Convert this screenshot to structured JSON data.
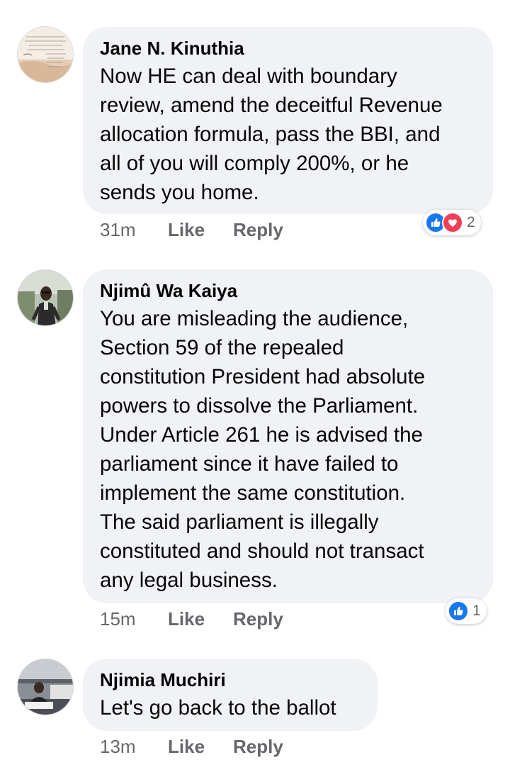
{
  "comments": [
    {
      "author": "Jane N. Kinuthia",
      "text": "Now HE can deal with boundary\nreview, amend the deceitful Revenue\nallocation formula, pass the BBI, and\nall of you will comply 200%, or he\nsends you home.",
      "time": "31m",
      "like_label": "Like",
      "reply_label": "Reply",
      "reactions": {
        "icons": [
          "like-icon",
          "love-icon"
        ],
        "count": "2"
      }
    },
    {
      "author": "Njimû Wa Kaiya",
      "text": "You are misleading the audience,\nSection 59 of the repealed\nconstitution President had absolute\npowers to dissolve the Parliament.\nUnder Article 261 he is advised the\nparliament since it have failed to\nimplement the same constitution.\nThe said parliament is illegally\nconstituted and should not transact\nany legal business.",
      "time": "15m",
      "like_label": "Like",
      "reply_label": "Reply",
      "reactions": {
        "icons": [
          "like-icon"
        ],
        "count": "1"
      }
    },
    {
      "author": "Njimia Muchiri",
      "text": "Let's go back to the ballot",
      "time": "13m",
      "like_label": "Like",
      "reply_label": "Reply"
    }
  ],
  "colors": {
    "bubble": "#f0f2f5",
    "secondary_text": "#65676b",
    "like_blue": "#1877f2",
    "love_red": "#f33e58"
  }
}
